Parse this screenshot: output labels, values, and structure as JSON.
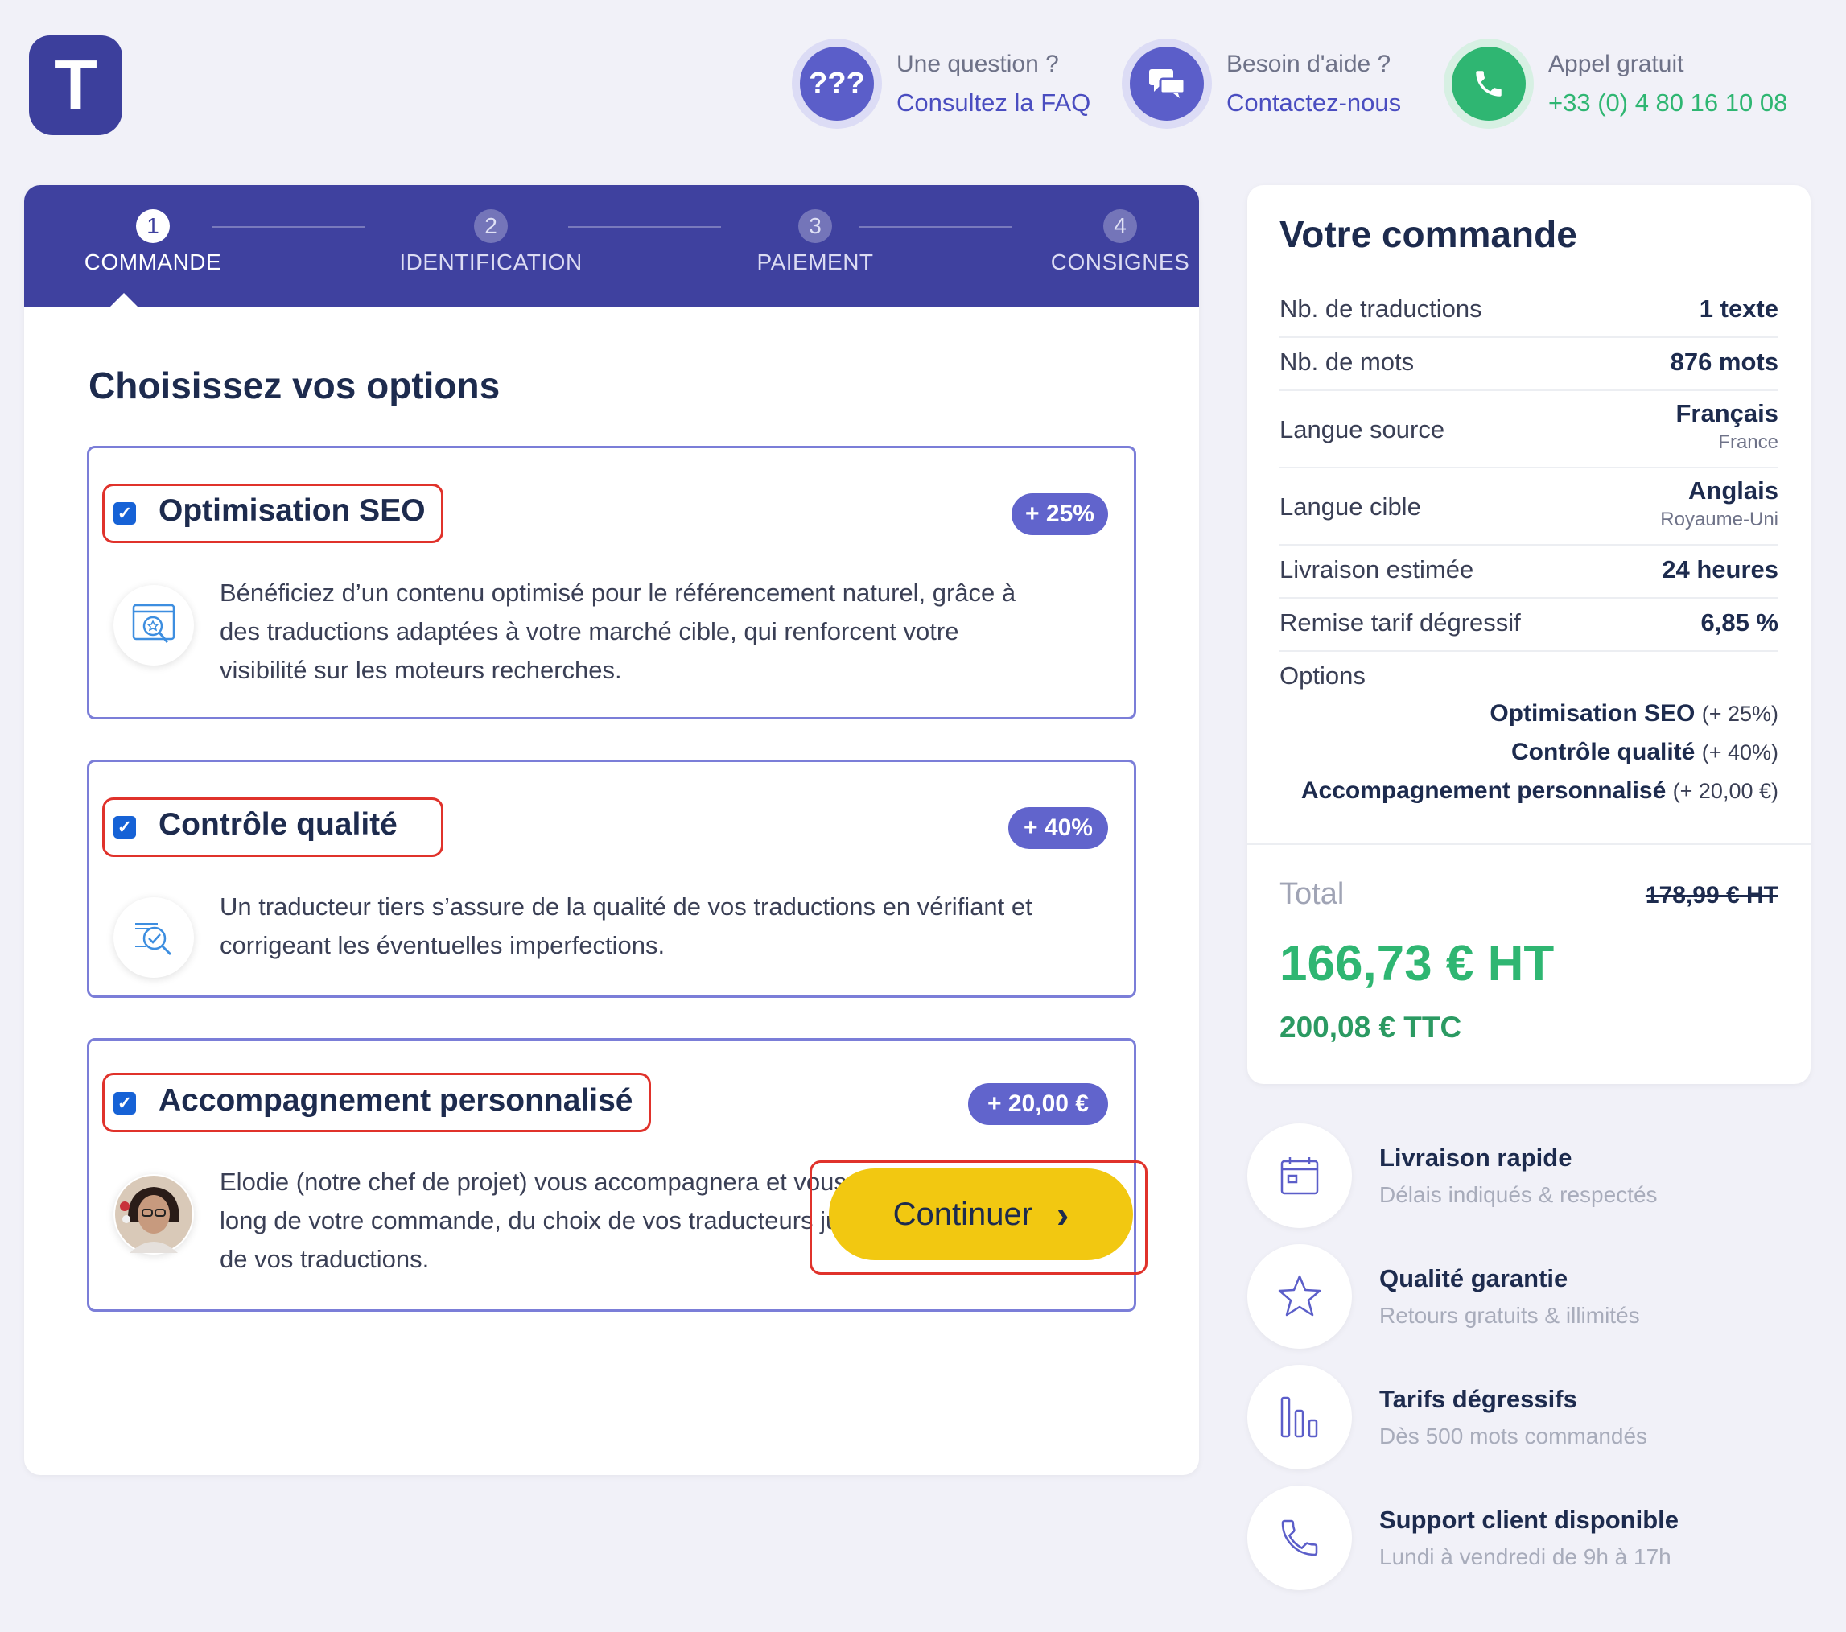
{
  "logo": {
    "letter": "T"
  },
  "header": {
    "faq": {
      "small": "Une question ?",
      "link": "Consultez la FAQ",
      "icon_text": "???"
    },
    "help": {
      "small": "Besoin d'aide ?",
      "link": "Contactez-nous"
    },
    "phone": {
      "small": "Appel gratuit",
      "link": "+33 (0) 4 80 16 10 08"
    }
  },
  "steps": [
    {
      "num": "1",
      "label": "COMMANDE",
      "active": true
    },
    {
      "num": "2",
      "label": "IDENTIFICATION",
      "active": false
    },
    {
      "num": "3",
      "label": "PAIEMENT",
      "active": false
    },
    {
      "num": "4",
      "label": "CONSIGNES",
      "active": false
    }
  ],
  "main": {
    "title": "Choisissez vos options",
    "options": [
      {
        "title": "Optimisation SEO",
        "badge": "+ 25%",
        "checked": true,
        "desc_lines": [
          "Bénéficiez d’un contenu optimisé pour le référencement naturel, grâce à",
          "des traductions adaptées à votre marché cible, qui renforcent votre",
          "visibilité sur les moteurs recherches."
        ],
        "icon": "seo-search-icon"
      },
      {
        "title": "Contrôle qualité",
        "badge": "+ 40%",
        "checked": true,
        "desc_lines": [
          "Un traducteur tiers s’assure de la qualité de vos traductions en vérifiant et",
          "corrigeant les éventuelles imperfections."
        ],
        "icon": "quality-check-icon"
      },
      {
        "title": "Accompagnement personnalisé",
        "badge": "+ 20,00 €",
        "checked": true,
        "desc_lines": [
          "Elodie (notre chef de projet) vous accompagnera et vous aidera tout au",
          "long de votre commande, du choix de vos traducteurs jusqu'à la livraison",
          "de vos traductions."
        ],
        "icon": "project-manager-avatar"
      }
    ],
    "continue_label": "Continuer",
    "continue_arrow": "›"
  },
  "summary": {
    "title": "Votre commande",
    "rows": [
      {
        "label": "Nb. de traductions",
        "value": "1 texte"
      },
      {
        "label": "Nb. de mots",
        "value": "876 mots"
      },
      {
        "label": "Langue source",
        "value": "Français",
        "sub": "France"
      },
      {
        "label": "Langue cible",
        "value": "Anglais",
        "sub": "Royaume-Uni"
      },
      {
        "label": "Livraison estimée",
        "value": "24 heures"
      },
      {
        "label": "Remise tarif dégressif",
        "value": "6,85 %"
      }
    ],
    "options_label": "Options",
    "options": [
      {
        "name": "Optimisation SEO",
        "extra": "(+ 25%)"
      },
      {
        "name": "Contrôle qualité",
        "extra": "(+ 40%)"
      },
      {
        "name": "Accompagnement personnalisé",
        "extra": "(+ 20,00 €)"
      }
    ],
    "total_label": "Total",
    "old_price": "178,99 € HT",
    "price_ht": "166,73 € HT",
    "price_ttc": "200,08 € TTC"
  },
  "features": [
    {
      "title": "Livraison rapide",
      "sub": "Délais indiqués & respectés",
      "icon": "calendar-icon"
    },
    {
      "title": "Qualité garantie",
      "sub": "Retours gratuits & illimités",
      "icon": "star-icon"
    },
    {
      "title": "Tarifs dégressifs",
      "sub": "Dès 500 mots commandés",
      "icon": "bar-chart-icon"
    },
    {
      "title": "Support client disponible",
      "sub": "Lundi à vendredi de 9h à 17h",
      "icon": "phone-icon"
    }
  ],
  "colors": {
    "primary": "#3f419f",
    "accent": "#6164cc",
    "green": "#2fb672",
    "yellow": "#f2c811",
    "highlight_red": "#e0322b"
  }
}
